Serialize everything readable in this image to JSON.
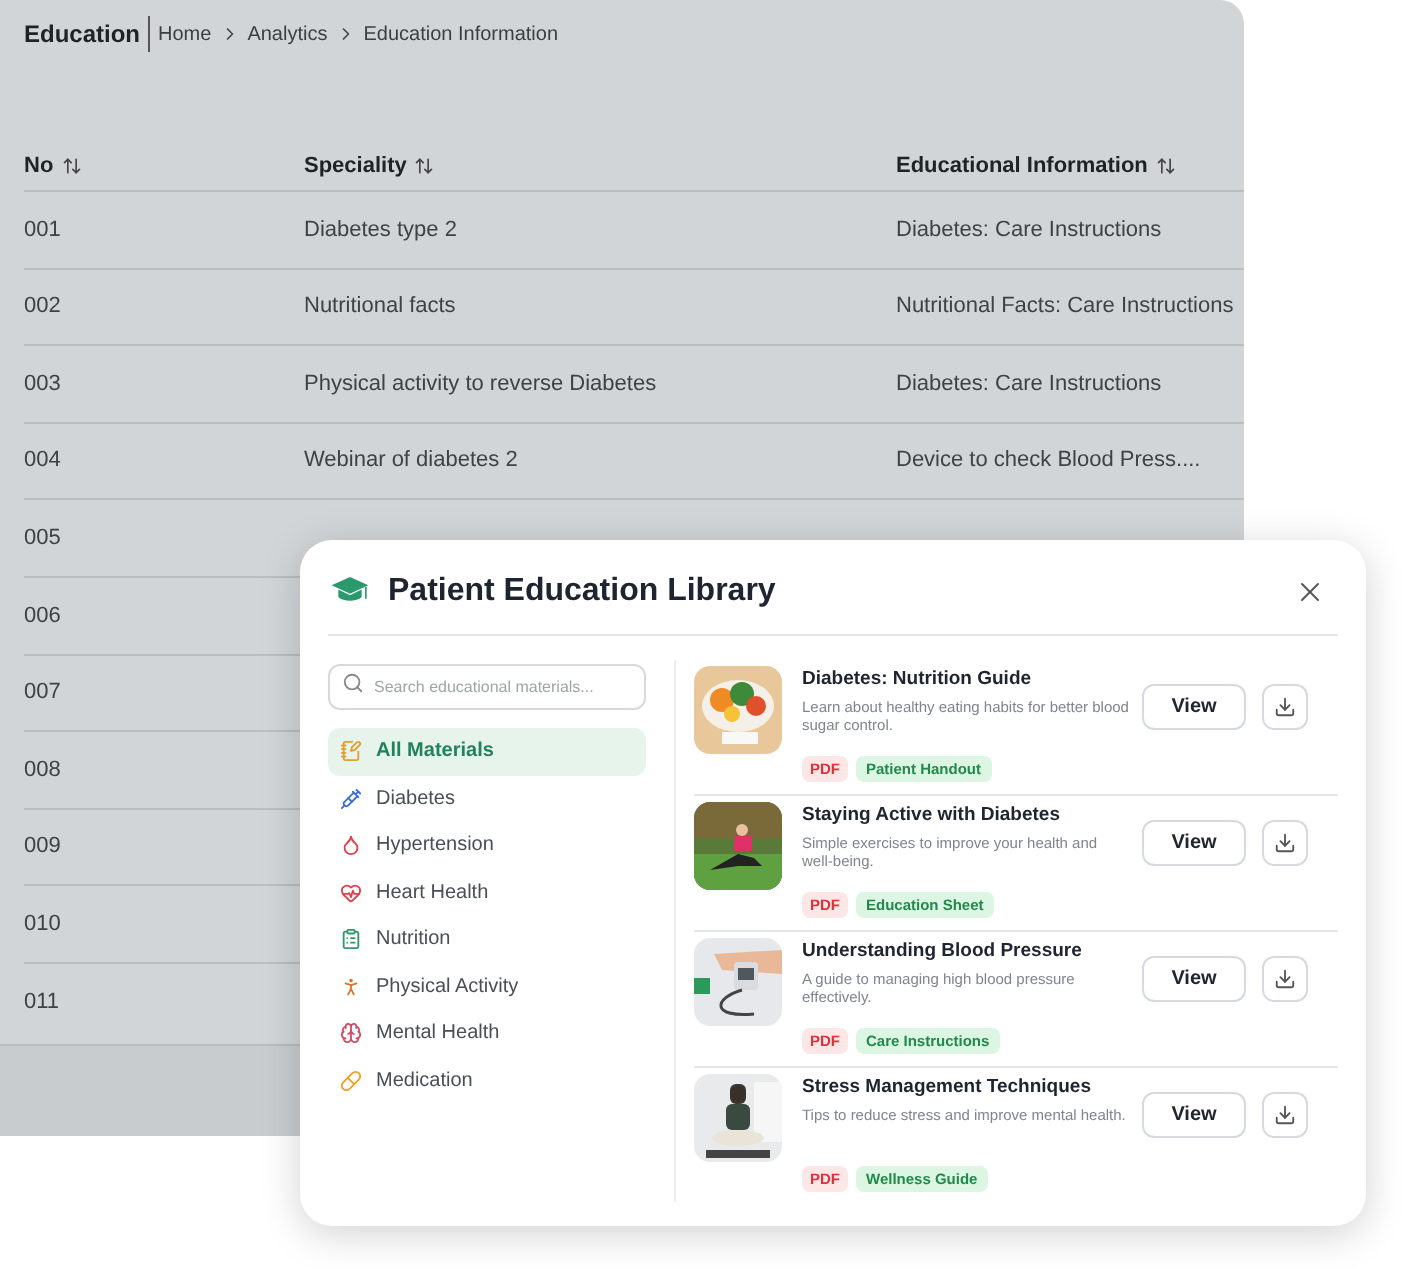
{
  "page": {
    "title": "Education",
    "breadcrumb": [
      "Home",
      "Analytics",
      "Education Information"
    ]
  },
  "table": {
    "columns": [
      "No",
      "Speciality",
      "Educational Information"
    ],
    "rows": [
      {
        "no": "001",
        "speciality": "Diabetes type 2",
        "information": "Diabetes: Care Instructions"
      },
      {
        "no": "002",
        "speciality": "Nutritional facts",
        "information": "Nutritional Facts: Care Instructions"
      },
      {
        "no": "003",
        "speciality": "Physical activity to reverse Diabetes",
        "information": "Diabetes: Care Instructions"
      },
      {
        "no": "004",
        "speciality": "Webinar of diabetes 2",
        "information": "Device to check Blood Press...."
      },
      {
        "no": "005"
      },
      {
        "no": "006"
      },
      {
        "no": "007"
      },
      {
        "no": "008"
      },
      {
        "no": "009"
      },
      {
        "no": "010"
      },
      {
        "no": "011"
      }
    ]
  },
  "dialog": {
    "title": "Patient Education Library",
    "search": {
      "placeholder": "Search educational materials..."
    },
    "categories": [
      {
        "label": "All Materials",
        "selected": true
      },
      {
        "label": "Diabetes",
        "selected": false
      },
      {
        "label": "Hypertension",
        "selected": false
      },
      {
        "label": "Heart Health",
        "selected": false
      },
      {
        "label": "Nutrition",
        "selected": false
      },
      {
        "label": "Physical Activity",
        "selected": false
      },
      {
        "label": "Mental Health",
        "selected": false
      },
      {
        "label": "Medication",
        "selected": false
      }
    ],
    "materials": [
      {
        "title": "Diabetes: Nutrition Guide",
        "description": "Learn about healthy eating habits for better blood sugar control.",
        "format": "PDF",
        "type": "Patient Handout",
        "button": "View"
      },
      {
        "title": "Staying Active with Diabetes",
        "description": "Simple exercises to improve your health and well-being.",
        "format": "PDF",
        "type": "Education Sheet",
        "button": "View"
      },
      {
        "title": "Understanding Blood Pressure",
        "description": "A guide to managing high blood pressure effectively.",
        "format": "PDF",
        "type": "Care Instructions",
        "button": "View"
      },
      {
        "title": "Stress Management Techniques",
        "description": "Tips to reduce stress and improve mental health.",
        "format": "PDF",
        "type": "Wellness Guide",
        "button": "View"
      }
    ]
  }
}
